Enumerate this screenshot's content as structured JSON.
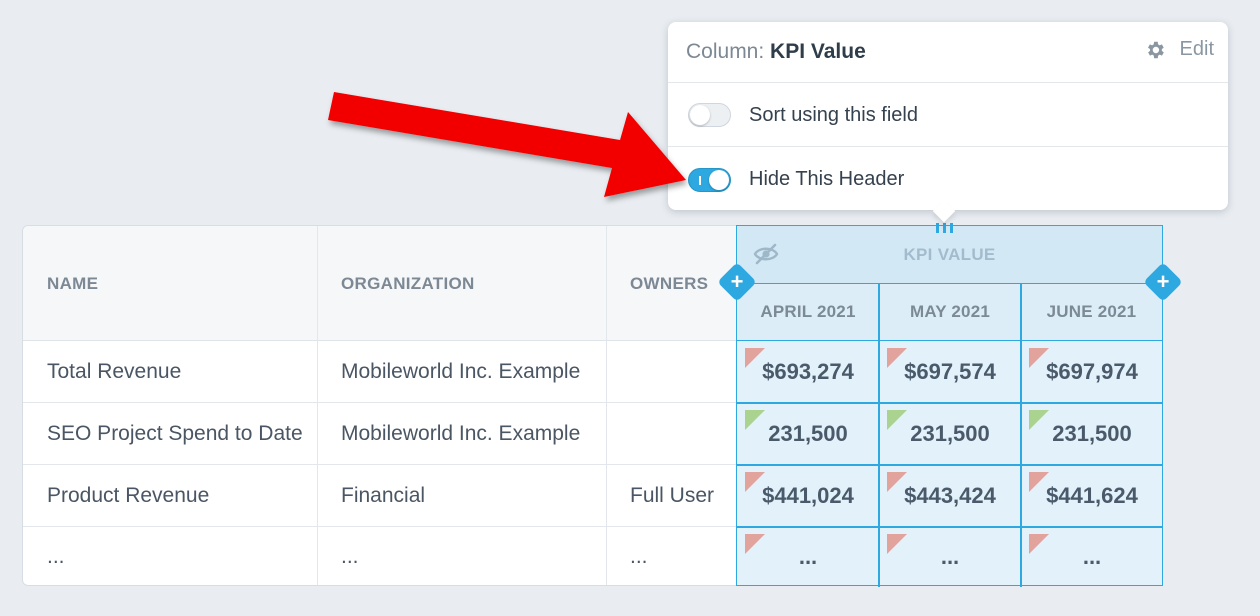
{
  "popover": {
    "title_prefix": "Column:",
    "title_value": "KPI Value",
    "edit_label": "Edit",
    "options": [
      {
        "label": "Sort using this field",
        "enabled": false
      },
      {
        "label": "Hide This Header",
        "enabled": true
      }
    ]
  },
  "table": {
    "headers": [
      "NAME",
      "ORGANIZATION",
      "OWNERS"
    ],
    "kpi_header": "KPI VALUE",
    "kpi_subheaders": [
      "APRIL 2021",
      "MAY 2021",
      "JUNE 2021"
    ],
    "rows": [
      {
        "name": "Total Revenue",
        "organization": "Mobileworld Inc. Example",
        "owners": "",
        "kpi": [
          "$693,274",
          "$697,574",
          "$697,974"
        ],
        "flag": "red"
      },
      {
        "name": "SEO Project Spend to Date",
        "organization": "Mobileworld Inc. Example",
        "owners": "",
        "kpi": [
          "231,500",
          "231,500",
          "231,500"
        ],
        "flag": "green"
      },
      {
        "name": "Product Revenue",
        "organization": "Financial",
        "owners": "Full User",
        "kpi": [
          "$441,024",
          "$443,424",
          "$441,624"
        ],
        "flag": "red"
      },
      {
        "name": "...",
        "organization": "...",
        "owners": "...",
        "kpi": [
          "...",
          "...",
          "..."
        ],
        "flag": "red"
      }
    ]
  },
  "colors": {
    "accent": "#2ea8e0",
    "arrow": "#f20000",
    "flag_red": "#e2a39d",
    "flag_green": "#a9d38f"
  }
}
